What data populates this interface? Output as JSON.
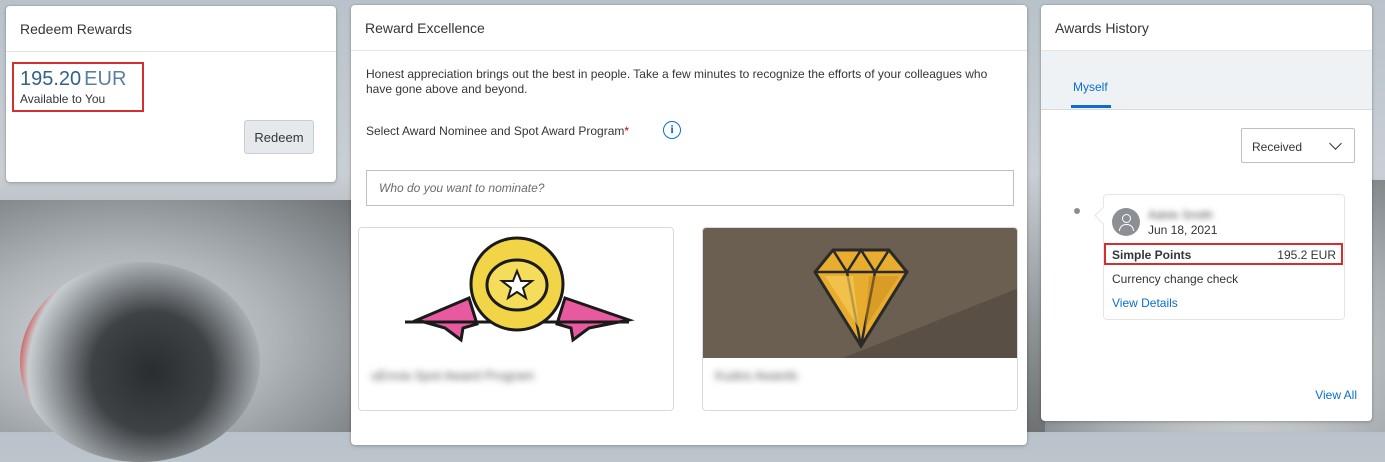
{
  "redeem": {
    "title": "Redeem Rewards",
    "amount": "195.20",
    "currency": "EUR",
    "available_label": "Available to You",
    "button_label": "Redeem"
  },
  "excellence": {
    "title": "Reward Excellence",
    "intro": "Honest appreciation brings out the best in people. Take a few minutes to recognize the efforts of your colleagues who have gone above and beyond.",
    "select_label": "Select Award Nominee and Spot Award Program",
    "required_marker": "*",
    "info_icon": "i",
    "nominee_placeholder": "Who do you want to nominate?",
    "programs": [
      {
        "name": "uEnvia Spot Award Program",
        "icon": "medal-icon"
      },
      {
        "name": "Kudos Awards",
        "icon": "diamond-icon"
      }
    ]
  },
  "history": {
    "title": "Awards History",
    "tabs": [
      {
        "label": "Myself"
      }
    ],
    "filter_value": "Received",
    "entry": {
      "sender": "Adele Smith",
      "date": "Jun 18, 2021",
      "points_label": "Simple Points",
      "points_value": "195.2 EUR",
      "message": "Currency change check",
      "link": "View Details"
    },
    "view_all": "View All"
  },
  "colors": {
    "accent": "#0a6ed1",
    "highlight_border": "#d32f2f",
    "amount": "#346187"
  }
}
